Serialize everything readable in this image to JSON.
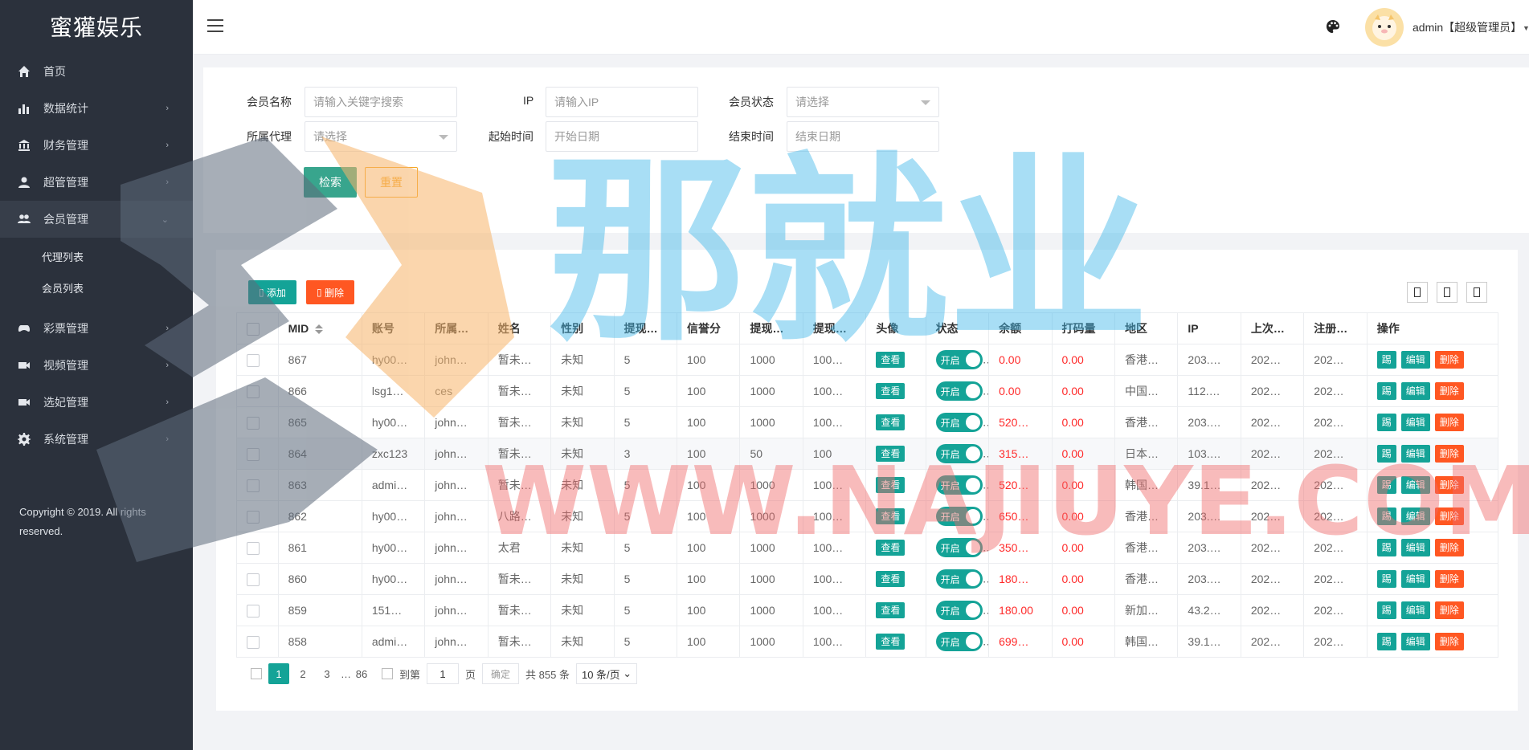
{
  "brand": "蜜獾娱乐",
  "sidebar": {
    "items": [
      {
        "label": "首页",
        "icon": "home-icon"
      },
      {
        "label": "数据统计",
        "icon": "bar-chart-icon"
      },
      {
        "label": "财务管理",
        "icon": "bank-icon"
      },
      {
        "label": "超管管理",
        "icon": "user-icon"
      },
      {
        "label": "会员管理",
        "icon": "users-icon"
      }
    ],
    "sub_items": [
      {
        "label": "代理列表"
      },
      {
        "label": "会员列表"
      }
    ],
    "items2": [
      {
        "label": "彩票管理",
        "icon": "gamepad-icon"
      },
      {
        "label": "视频管理",
        "icon": "video-icon"
      },
      {
        "label": "选妃管理",
        "icon": "camera-icon"
      },
      {
        "label": "系统管理",
        "icon": "gear-icon"
      }
    ],
    "copyright": "Copyright © 2019. All rights reserved."
  },
  "header": {
    "user": "admin【超级管理员】"
  },
  "search": {
    "member_name_label": "会员名称",
    "member_name_placeholder": "请输入关键字搜索",
    "ip_label": "IP",
    "ip_placeholder": "请输入IP",
    "status_label": "会员状态",
    "status_placeholder": "请选择",
    "agent_label": "所属代理",
    "agent_placeholder": "请选择",
    "start_label": "起始时间",
    "start_placeholder": "开始日期",
    "end_label": "结束时间",
    "end_placeholder": "结束日期",
    "search_btn": "检索",
    "reset_btn": "重置"
  },
  "toolbar": {
    "add_label": "添加",
    "delete_label": "删除"
  },
  "table": {
    "columns": [
      "MID",
      "账号",
      "所属…",
      "姓名",
      "性别",
      "提现…",
      "信誉分",
      "提现…",
      "提现…",
      "头像",
      "状态",
      "余额",
      "打码量",
      "地区",
      "IP",
      "上次…",
      "注册…",
      "操作"
    ],
    "view_label": "查看",
    "switch_label": "开启",
    "op_labels": [
      "踢",
      "编辑",
      "删除"
    ],
    "rows": [
      {
        "mid": "867",
        "account": "hy00…",
        "agent": "john…",
        "name": "暂未…",
        "gender": "未知",
        "w1": "5",
        "credit": "100",
        "w2": "1000",
        "w3": "100…",
        "balance": "0.00",
        "code": "0.00",
        "region": "香港…",
        "ip": "203.…",
        "last": "202…",
        "reg": "202…"
      },
      {
        "mid": "866",
        "account": "lsg1…",
        "agent": "ces",
        "name": "暂未…",
        "gender": "未知",
        "w1": "5",
        "credit": "100",
        "w2": "1000",
        "w3": "100…",
        "balance": "0.00",
        "code": "0.00",
        "region": "中国…",
        "ip": "112.…",
        "last": "202…",
        "reg": "202…"
      },
      {
        "mid": "865",
        "account": "hy00…",
        "agent": "john…",
        "name": "暂未…",
        "gender": "未知",
        "w1": "5",
        "credit": "100",
        "w2": "1000",
        "w3": "100…",
        "balance": "520…",
        "code": "0.00",
        "region": "香港…",
        "ip": "203.…",
        "last": "202…",
        "reg": "202…"
      },
      {
        "mid": "864",
        "account": "zxc123",
        "agent": "john…",
        "name": "暂未…",
        "gender": "未知",
        "w1": "3",
        "credit": "100",
        "w2": "50",
        "w3": "100",
        "balance": "315…",
        "code": "0.00",
        "region": "日本…",
        "ip": "103.…",
        "last": "202…",
        "reg": "202…"
      },
      {
        "mid": "863",
        "account": "admi…",
        "agent": "john…",
        "name": "暂未…",
        "gender": "未知",
        "w1": "5",
        "credit": "100",
        "w2": "1000",
        "w3": "100…",
        "balance": "520…",
        "code": "0.00",
        "region": "韩国…",
        "ip": "39.1…",
        "last": "202…",
        "reg": "202…"
      },
      {
        "mid": "862",
        "account": "hy00…",
        "agent": "john…",
        "name": "八路…",
        "gender": "未知",
        "w1": "5",
        "credit": "100",
        "w2": "1000",
        "w3": "100…",
        "balance": "650…",
        "code": "0.00",
        "region": "香港…",
        "ip": "203.…",
        "last": "202…",
        "reg": "202…"
      },
      {
        "mid": "861",
        "account": "hy00…",
        "agent": "john…",
        "name": "太君",
        "gender": "未知",
        "w1": "5",
        "credit": "100",
        "w2": "1000",
        "w3": "100…",
        "balance": "350…",
        "code": "0.00",
        "region": "香港…",
        "ip": "203.…",
        "last": "202…",
        "reg": "202…"
      },
      {
        "mid": "860",
        "account": "hy00…",
        "agent": "john…",
        "name": "暂未…",
        "gender": "未知",
        "w1": "5",
        "credit": "100",
        "w2": "1000",
        "w3": "100…",
        "balance": "180…",
        "code": "0.00",
        "region": "香港…",
        "ip": "203.…",
        "last": "202…",
        "reg": "202…"
      },
      {
        "mid": "859",
        "account": "151…",
        "agent": "john…",
        "name": "暂未…",
        "gender": "未知",
        "w1": "5",
        "credit": "100",
        "w2": "1000",
        "w3": "100…",
        "balance": "180.00",
        "code": "0.00",
        "region": "新加…",
        "ip": "43.2…",
        "last": "202…",
        "reg": "202…"
      },
      {
        "mid": "858",
        "account": "admi…",
        "agent": "john…",
        "name": "暂未…",
        "gender": "未知",
        "w1": "5",
        "credit": "100",
        "w2": "1000",
        "w3": "100…",
        "balance": "699…",
        "code": "0.00",
        "region": "韩国…",
        "ip": "39.1…",
        "last": "202…",
        "reg": "202…"
      }
    ]
  },
  "pager": {
    "pages": [
      "1",
      "2",
      "3"
    ],
    "ellipsis": "…",
    "last": "86",
    "goto": "到第",
    "current": "1",
    "page_unit": "页",
    "confirm": "确定",
    "total": "共 855 条",
    "page_size": "10 条/页"
  },
  "watermark": {
    "text": "那就业",
    "url": "WWW.NAJIUYE.COM"
  },
  "colors": {
    "sidebar": "#2b313c",
    "accent": "#14a397",
    "danger": "#ff5722",
    "warning": "#f5a623",
    "balance": "#ff2b2b"
  }
}
